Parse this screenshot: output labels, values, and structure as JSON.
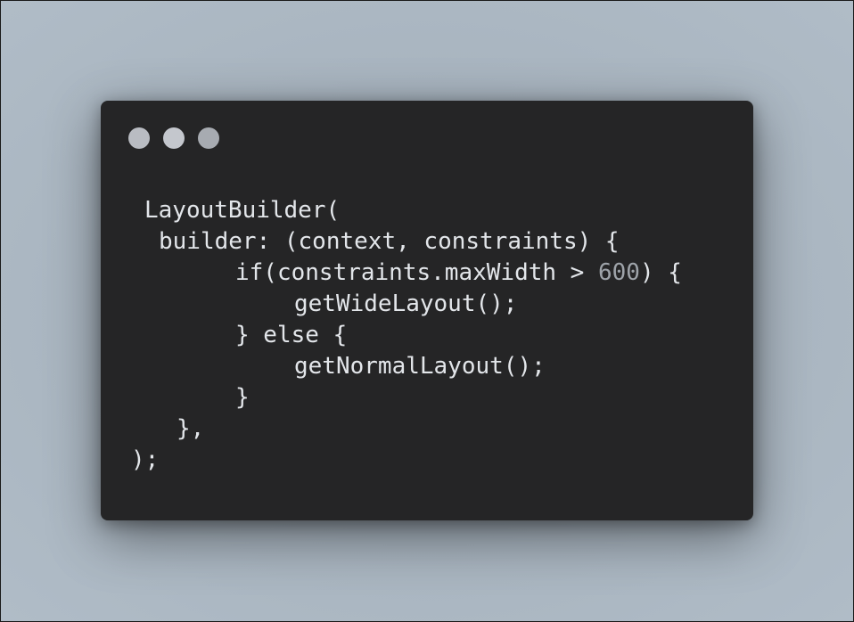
{
  "window": {
    "controls": [
      "dot-1",
      "dot-2",
      "dot-3"
    ]
  },
  "code": {
    "lines": [
      "LayoutBuilder(",
      "builder: (context, constraints) {",
      "if(constraints.maxWidth > ",
      "600",
      ") {",
      "getWideLayout();",
      "} else {",
      "getNormalLayout();",
      "}",
      "},",
      ");"
    ]
  },
  "colors": {
    "background": "#abb8c3",
    "window": "#252526",
    "text": "#e3e6ea",
    "number": "#9ea3a9"
  }
}
